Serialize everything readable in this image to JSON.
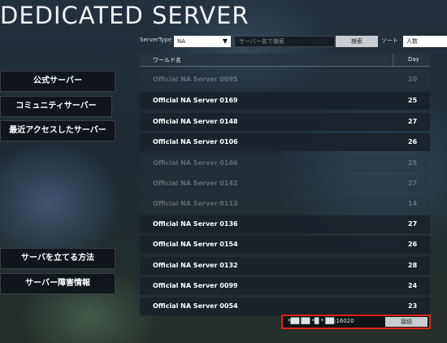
{
  "window": {
    "title": "DEDICATED SERVER"
  },
  "filter": {
    "server_type_label": "ServerType",
    "server_type_value": "NA",
    "search_placeholder": "サーバー名で検索",
    "search_button": "検索",
    "sort_label": "ソート",
    "sort_value": "人数"
  },
  "table": {
    "columns": {
      "name": "ワールド名",
      "day": "Day"
    },
    "rows": [
      {
        "name": "Official NA Server 0095",
        "day": "20",
        "faded": true
      },
      {
        "name": "Official NA Server 0169",
        "day": "25",
        "faded": false
      },
      {
        "name": "Official NA Server 0148",
        "day": "27",
        "faded": false
      },
      {
        "name": "Official NA Server 0106",
        "day": "26",
        "faded": false
      },
      {
        "name": "Official NA Server 0166",
        "day": "25",
        "faded": true
      },
      {
        "name": "Official NA Server 0142",
        "day": "27",
        "faded": true
      },
      {
        "name": "Official NA Server 0113",
        "day": "14",
        "faded": true
      },
      {
        "name": "Official NA Server 0136",
        "day": "27",
        "faded": false
      },
      {
        "name": "Official NA Server 0154",
        "day": "26",
        "faded": false
      },
      {
        "name": "Official NA Server 0132",
        "day": "28",
        "faded": false
      },
      {
        "name": "Official NA Server 0099",
        "day": "24",
        "faded": false
      },
      {
        "name": "Official NA Server 0054",
        "day": "23",
        "faded": false
      }
    ]
  },
  "sidebar": {
    "official": "公式サーバー",
    "community": "コミュニティサーバー",
    "recent": "最近アクセスしたサーバー",
    "how_to_host": "サーバを立てる方法",
    "outage_info": "サーバー障害情報"
  },
  "connect": {
    "address": "*██ ██ *█ * ██:16020",
    "button": "接続",
    "highlight_color": "#e02020"
  }
}
